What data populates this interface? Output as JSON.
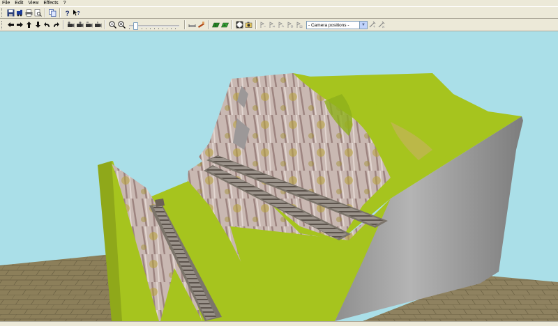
{
  "menu": [
    "File",
    "Edit",
    "View",
    "Effects",
    "?"
  ],
  "camera_select": {
    "selected": "- Camera positions -"
  },
  "colors": {
    "sky": "#aadfe8",
    "grass": "#a6c41e",
    "rock": "#c9b8b2",
    "concrete": "#a3a3a3",
    "floor": "#8c7f5a",
    "rail": "#8a817a"
  },
  "icons": {
    "toolbar1": [
      "save-icon",
      "train-icon",
      "print-icon",
      "print-preview-icon",
      "copy-icon",
      "help-icon",
      "context-help-icon"
    ],
    "toolbar2_nav": [
      "arrow-left-icon",
      "arrow-right-icon",
      "arrow-up-icon",
      "arrow-down-icon",
      "turn-left-icon",
      "turn-right-icon"
    ],
    "toolbar2_camera": [
      "camera-a-icon",
      "camera-b-icon",
      "camera-c-icon",
      "camera-d-icon"
    ],
    "toolbar2_zoom": [
      "zoom-out-icon",
      "zoom-in-icon"
    ],
    "toolbar2_tools": [
      "track-tool-icon",
      "signal-tool-icon",
      "grid-icon",
      "terrain-icon",
      "fit-view-icon",
      "screenshot-icon"
    ],
    "toolbar2_markers": [
      "marker-1-icon",
      "marker-2-icon",
      "marker-3-icon",
      "marker-4-icon",
      "marker-5-icon",
      "add-camera-icon",
      "remove-camera-icon"
    ]
  }
}
